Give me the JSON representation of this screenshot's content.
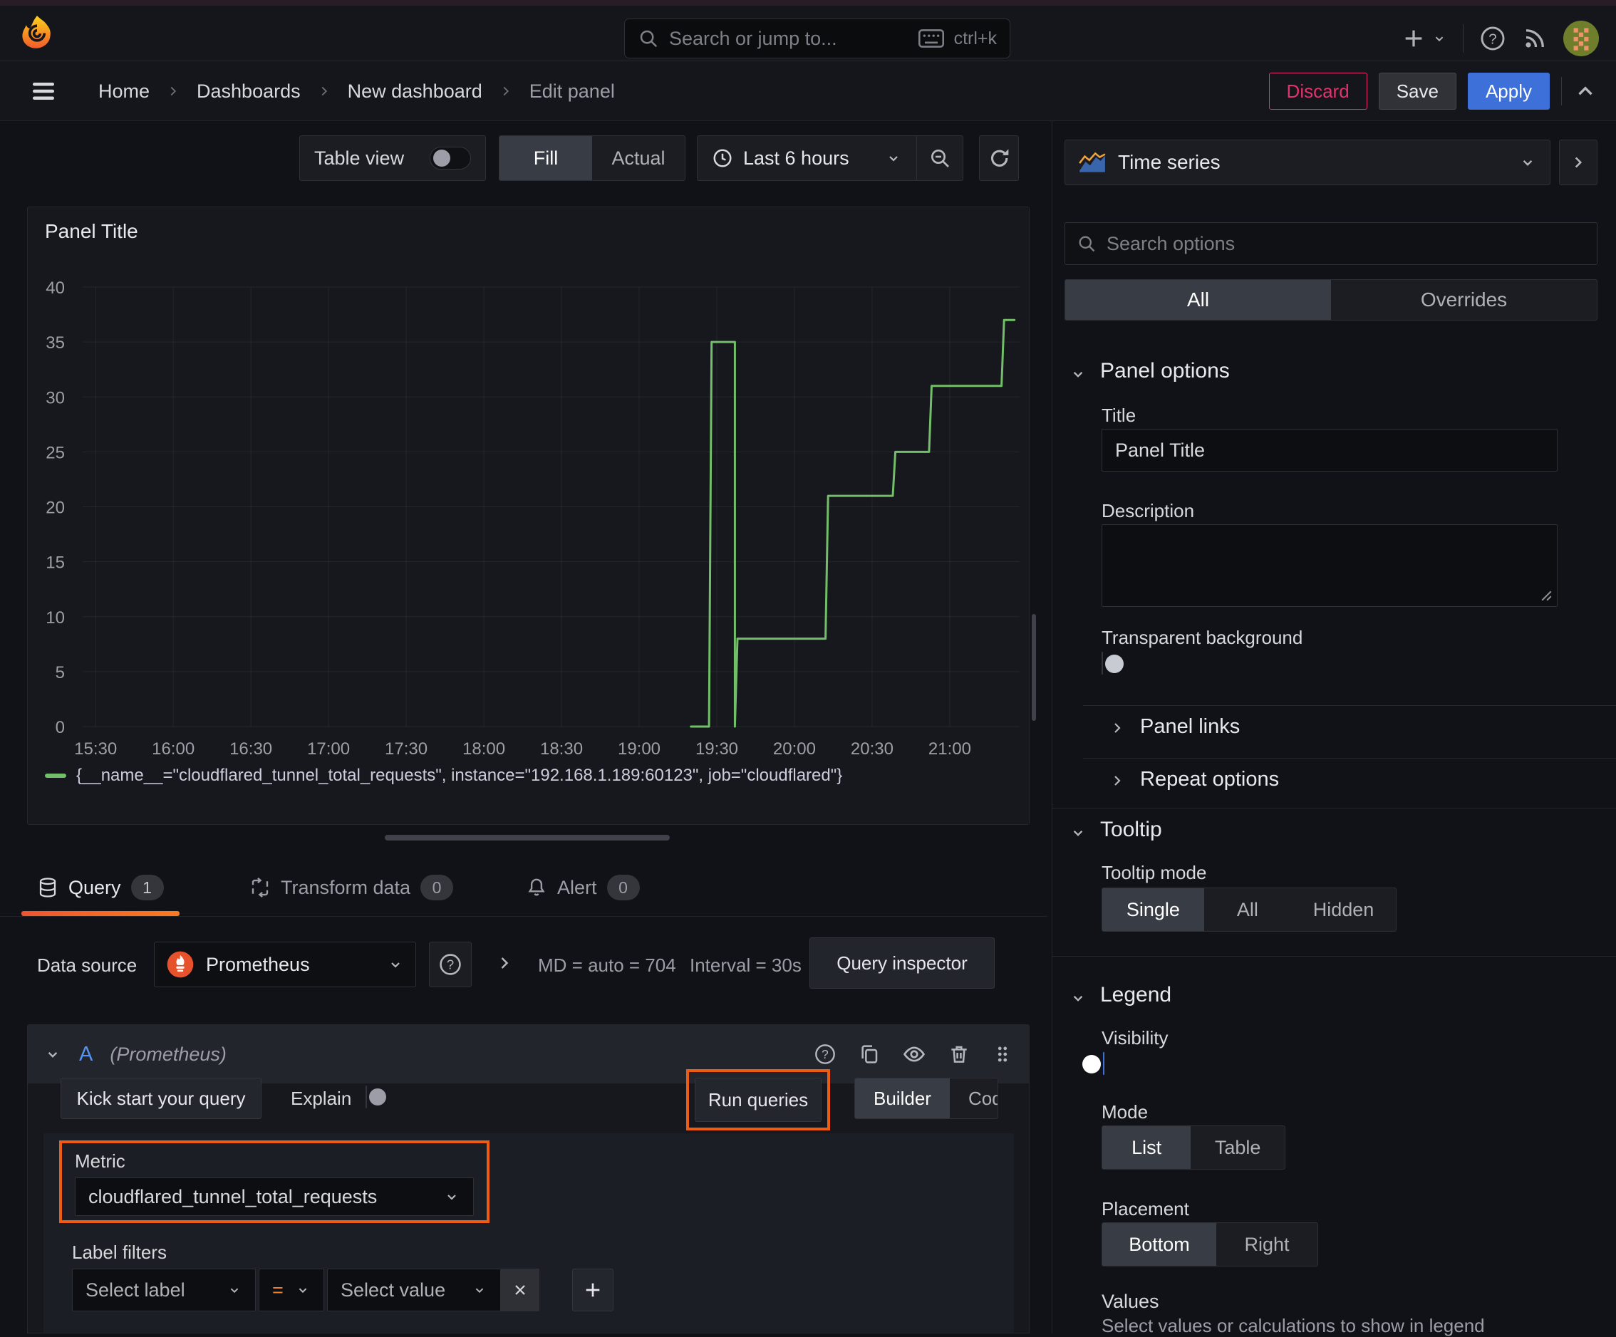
{
  "colors": {
    "accent_orange": "#ee5b13",
    "primary_blue": "#3d71d9",
    "series_green": "#73bf69",
    "danger_pink": "#e0326c"
  },
  "header": {
    "search_placeholder": "Search or jump to...",
    "search_shortcut": "ctrl+k"
  },
  "breadcrumb": {
    "items": [
      "Home",
      "Dashboards",
      "New dashboard",
      "Edit panel"
    ],
    "discard": "Discard",
    "save": "Save",
    "apply": "Apply"
  },
  "toolbar": {
    "table_view": "Table view",
    "fill": "Fill",
    "actual": "Actual",
    "time_range": "Last 6 hours"
  },
  "panel": {
    "title": "Panel Title"
  },
  "chart_data": {
    "type": "line",
    "title": "Panel Title",
    "xlabel": "",
    "ylabel": "",
    "ylim": [
      0,
      40
    ],
    "y_tick_step": 5,
    "x_ticks": [
      "15:30",
      "16:00",
      "16:30",
      "17:00",
      "17:30",
      "18:00",
      "18:30",
      "19:00",
      "19:30",
      "20:00",
      "20:30",
      "21:00"
    ],
    "x_domain": [
      "15:25",
      "21:27"
    ],
    "grid": true,
    "legend_position": "bottom",
    "line_color": "#73bf69",
    "series": [
      {
        "name": "{__name__=\"cloudflared_tunnel_total_requests\", instance=\"192.168.1.189:60123\", job=\"cloudflared\"}",
        "points": [
          [
            "19:20",
            0
          ],
          [
            "19:27",
            0
          ],
          [
            "19:28",
            35
          ],
          [
            "19:37",
            35
          ],
          [
            "19:37",
            0
          ],
          [
            "19:38",
            8
          ],
          [
            "20:12",
            8
          ],
          [
            "20:13",
            21
          ],
          [
            "20:38",
            21
          ],
          [
            "20:39",
            25
          ],
          [
            "20:52",
            25
          ],
          [
            "20:53",
            31
          ],
          [
            "21:20",
            31
          ],
          [
            "21:21",
            37
          ],
          [
            "21:25",
            37
          ]
        ]
      }
    ]
  },
  "tabs": {
    "query": "Query",
    "query_count": "1",
    "transform": "Transform data",
    "transform_count": "0",
    "alert": "Alert",
    "alert_count": "0"
  },
  "datasource": {
    "label": "Data source",
    "name": "Prometheus",
    "md": "MD = auto = 704",
    "interval": "Interval = 30s",
    "inspector": "Query inspector"
  },
  "query": {
    "ref": "A",
    "ds_hint": "(Prometheus)",
    "kickstart": "Kick start your query",
    "explain": "Explain",
    "run": "Run queries",
    "builder": "Builder",
    "code": "Code",
    "metric_label": "Metric",
    "metric_value": "cloudflared_tunnel_total_requests",
    "label_filters": "Label filters",
    "select_label": "Select label",
    "operator": "=",
    "select_value": "Select value"
  },
  "sidebar": {
    "viz_name": "Time series",
    "search_placeholder": "Search options",
    "tab_all": "All",
    "tab_overrides": "Overrides",
    "panel_options": {
      "title": "Panel options",
      "title_label": "Title",
      "title_value": "Panel Title",
      "description_label": "Description",
      "transparent_label": "Transparent background",
      "links": "Panel links",
      "repeat": "Repeat options"
    },
    "tooltip": {
      "title": "Tooltip",
      "mode_label": "Tooltip mode",
      "single": "Single",
      "all": "All",
      "hidden": "Hidden"
    },
    "legend": {
      "title": "Legend",
      "visibility": "Visibility",
      "mode_label": "Mode",
      "list": "List",
      "table": "Table",
      "placement_label": "Placement",
      "bottom": "Bottom",
      "right": "Right",
      "values_label": "Values",
      "values_help": "Select values or calculations to show in legend"
    }
  }
}
